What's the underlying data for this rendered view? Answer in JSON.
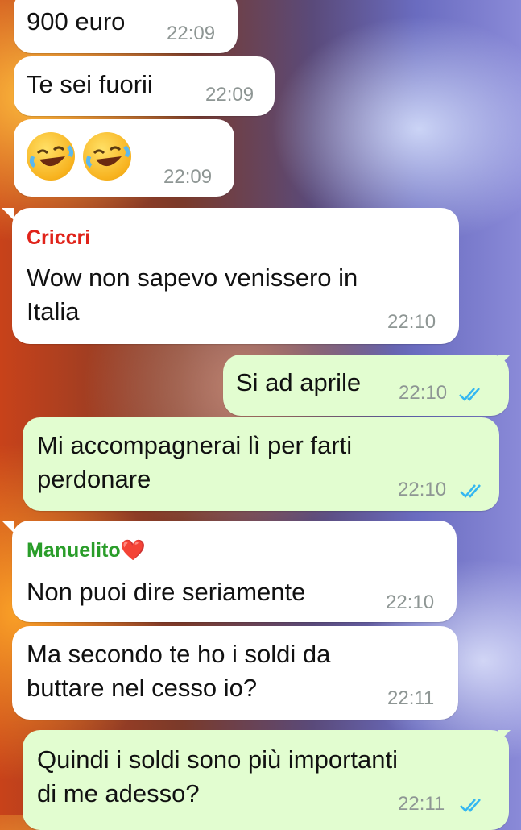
{
  "messages": [
    {
      "text": "900 euro",
      "time": "22:09"
    },
    {
      "text": "Te sei fuorii",
      "time": "22:09"
    },
    {
      "emoji": "rolling-on-floor-laughing x2",
      "time": "22:09"
    },
    {
      "sender": "Criccri",
      "sender_color": "#e0231a",
      "lines": [
        "Wow non sapevo venissero in",
        "Italia"
      ],
      "time": "22:10"
    },
    {
      "text": "Si ad aprile",
      "time": "22:10",
      "status": "read"
    },
    {
      "lines": [
        "Mi accompagnerai lì per farti",
        "perdonare"
      ],
      "time": "22:10",
      "status": "read"
    },
    {
      "sender": "Manuelito",
      "sender_suffix": "❤️",
      "sender_color": "#2a9d2a",
      "text": "Non puoi dire seriamente",
      "time": "22:10"
    },
    {
      "lines": [
        "Ma secondo te ho i soldi da",
        "buttare nel cesso io?"
      ],
      "time": "22:11"
    },
    {
      "lines": [
        "Quindi i soldi sono più importanti",
        "di me adesso?"
      ],
      "time": "22:11",
      "status": "read"
    }
  ],
  "colors": {
    "incoming": "#ffffff",
    "outgoing": "#e2fdd0",
    "read_tick": "#34b7f1"
  }
}
